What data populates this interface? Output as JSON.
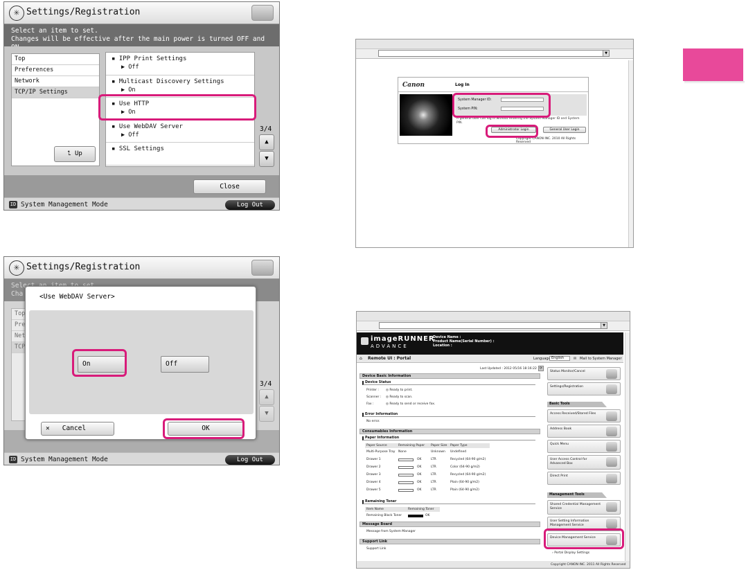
{
  "panel1": {
    "title": "Settings/Registration",
    "msg1": "Select an item to set.",
    "msg2": "Changes will be effective after the main power is turned OFF and ON.",
    "nav": [
      "Top",
      "Preferences",
      "Network",
      "TCP/IP Settings"
    ],
    "up_label": "Up",
    "settings": [
      {
        "name": "IPP Print Settings",
        "value": "Off"
      },
      {
        "name": "Multicast Discovery Settings",
        "value": "On"
      },
      {
        "name": "Use HTTP",
        "value": "On"
      },
      {
        "name": "Use WebDAV Server",
        "value": "Off"
      },
      {
        "name": "SSL Settings",
        "value": ""
      }
    ],
    "page": "3/4",
    "close_label": "Close",
    "mode": "System Management Mode",
    "logout": "Log Out"
  },
  "panel2": {
    "title": "Settings/Registration",
    "msg1": "Select an item to set.",
    "msg2": "Cha",
    "nav": [
      "Top",
      "Prefe",
      "Netw",
      "TCP"
    ],
    "page": "3/4",
    "dialog_title": "<Use WebDAV Server>",
    "on_label": "On",
    "off_label": "Off",
    "cancel_label": "Cancel",
    "ok_label": "OK",
    "mode": "System Management Mode",
    "logout": "Log Out"
  },
  "login": {
    "brand": "Canon",
    "title": "Log In",
    "id_label": "System Manager ID:",
    "pin_label": "System PIN:",
    "note": "A general user can log in without entering the System Manager ID and System PIN.",
    "admin_btn": "Administrator Login",
    "general_btn": "General User Login",
    "copyright": "Copyright CANON INC. 2010 All Rights Reserved"
  },
  "portal": {
    "brand": "imageRUNNER",
    "brand2": "ADVANCE",
    "device_name": "Device Name :",
    "product_name": "Product Name(Serial Number) :",
    "location": "Location :",
    "page_title": "Remote UI : Portal",
    "language_label": "Language:",
    "language_value": "English",
    "mail_link": "Mail to System Manager",
    "last_updated": "Last Updated : 2012 05/16 18:16:22",
    "basic_info": "Device Basic Information",
    "device_status": "Device Status",
    "status_rows": [
      {
        "k": "Printer :",
        "v": "Ready to print."
      },
      {
        "k": "Scanner :",
        "v": "Ready to scan."
      },
      {
        "k": "Fax :",
        "v": "Ready to send or receive fax."
      }
    ],
    "error_info": "Error Information",
    "no_error": "No error.",
    "consumables": "Consumables Information",
    "paper_info": "Paper Information",
    "paper_headers": [
      "Paper Source",
      "Remaining Paper",
      "Paper Size",
      "Paper Type"
    ],
    "paper_rows": [
      [
        "Multi-Purpose Tray",
        "None",
        "Unknown",
        "Undefined"
      ],
      [
        "Drawer 1",
        "OK",
        "LTR",
        "Recycled (64-90 g/m2)"
      ],
      [
        "Drawer 2",
        "OK",
        "LTR",
        "Color (64-90 g/m2)"
      ],
      [
        "Drawer 3",
        "OK",
        "LTR",
        "Recycled (64-90 g/m2)"
      ],
      [
        "Drawer 4",
        "OK",
        "LTR",
        "Plain (64-90 g/m2)"
      ],
      [
        "Drawer 5",
        "OK",
        "LTR",
        "Plain (64-90 g/m2)"
      ]
    ],
    "toner": "Remaining Toner",
    "toner_headers": [
      "Item Name",
      "Remaining Toner"
    ],
    "toner_row": [
      "Remaining Black Toner",
      "OK"
    ],
    "message_board": "Message Board",
    "message_text": "Message from System Manager",
    "support_link": "Support Link",
    "support_text": "Support Link",
    "right_top": [
      "Status Monitor/Cancel",
      "Settings/Registration"
    ],
    "basic_tools": "Basic Tools",
    "basic_items": [
      "Access Received/Stored Files",
      "Address Book",
      "Quick Menu",
      "User Access Control for Advanced Box",
      "Direct Print"
    ],
    "mgmt_tools": "Management Tools",
    "mgmt_items": [
      "Shared Credential Management Service",
      "User Setting Information Management Service",
      "Device Management Service"
    ],
    "portal_settings": "Portal Display Settings",
    "copyright": "Copyright CANON INC. 2011 All Rights Reserved"
  }
}
